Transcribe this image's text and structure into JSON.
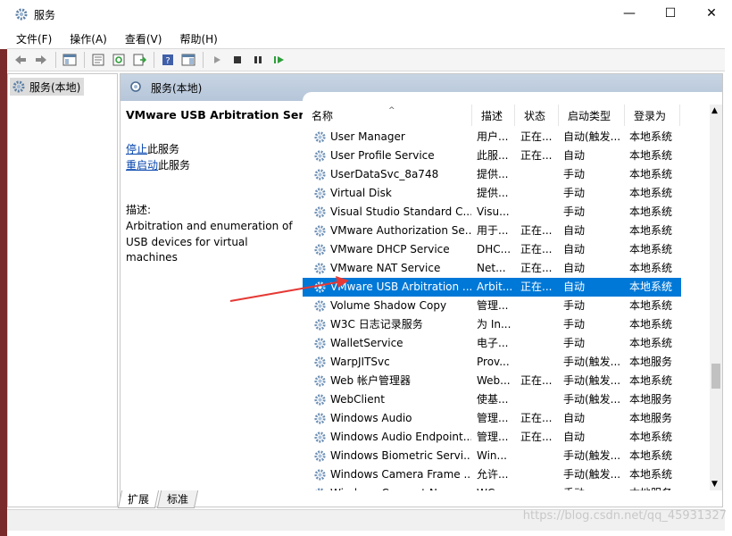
{
  "window": {
    "title": "服务",
    "buttons": [
      "—",
      "☐",
      "✕"
    ]
  },
  "menu": [
    "文件(F)",
    "操作(A)",
    "查看(V)",
    "帮助(H)"
  ],
  "tree": {
    "item": "服务(本地)"
  },
  "panel": {
    "header": "服务(本地)"
  },
  "description_panel": {
    "service_title": "VMware USB Arbitration Service",
    "stop_link": "停止",
    "stop_suffix": "此服务",
    "restart_link": "重启动",
    "restart_suffix": "此服务",
    "desc_label": "描述:",
    "desc_text": "Arbitration and enumeration of USB devices for virtual machines"
  },
  "columns": [
    "名称",
    "描述",
    "状态",
    "启动类型",
    "登录为"
  ],
  "rows": [
    {
      "name": "User Manager",
      "desc": "用户...",
      "status": "正在...",
      "start": "自动(触发...",
      "logon": "本地系统"
    },
    {
      "name": "User Profile Service",
      "desc": "此服...",
      "status": "正在...",
      "start": "自动",
      "logon": "本地系统"
    },
    {
      "name": "UserDataSvc_8a748",
      "desc": "提供...",
      "status": "",
      "start": "手动",
      "logon": "本地系统"
    },
    {
      "name": "Virtual Disk",
      "desc": "提供...",
      "status": "",
      "start": "手动",
      "logon": "本地系统"
    },
    {
      "name": "Visual Studio Standard C...",
      "desc": "Visu...",
      "status": "",
      "start": "手动",
      "logon": "本地系统"
    },
    {
      "name": "VMware Authorization Se...",
      "desc": "用于...",
      "status": "正在...",
      "start": "自动",
      "logon": "本地系统"
    },
    {
      "name": "VMware DHCP Service",
      "desc": "DHC...",
      "status": "正在...",
      "start": "自动",
      "logon": "本地系统"
    },
    {
      "name": "VMware NAT Service",
      "desc": "Net...",
      "status": "正在...",
      "start": "自动",
      "logon": "本地系统"
    },
    {
      "name": "VMware USB Arbitration ...",
      "desc": "Arbit...",
      "status": "正在...",
      "start": "自动",
      "logon": "本地系统",
      "selected": true
    },
    {
      "name": "Volume Shadow Copy",
      "desc": "管理...",
      "status": "",
      "start": "手动",
      "logon": "本地系统"
    },
    {
      "name": "W3C 日志记录服务",
      "desc": "为 In...",
      "status": "",
      "start": "手动",
      "logon": "本地系统"
    },
    {
      "name": "WalletService",
      "desc": "电子...",
      "status": "",
      "start": "手动",
      "logon": "本地系统"
    },
    {
      "name": "WarpJITSvc",
      "desc": "Prov...",
      "status": "",
      "start": "手动(触发...",
      "logon": "本地服务"
    },
    {
      "name": "Web 帐户管理器",
      "desc": "Web...",
      "status": "正在...",
      "start": "手动(触发...",
      "logon": "本地系统"
    },
    {
      "name": "WebClient",
      "desc": "使基...",
      "status": "",
      "start": "手动(触发...",
      "logon": "本地服务"
    },
    {
      "name": "Windows Audio",
      "desc": "管理...",
      "status": "正在...",
      "start": "自动",
      "logon": "本地服务"
    },
    {
      "name": "Windows Audio Endpoint...",
      "desc": "管理...",
      "status": "正在...",
      "start": "自动",
      "logon": "本地系统"
    },
    {
      "name": "Windows Biometric Servi...",
      "desc": "Win...",
      "status": "",
      "start": "手动(触发...",
      "logon": "本地系统"
    },
    {
      "name": "Windows Camera Frame ...",
      "desc": "允许...",
      "status": "",
      "start": "手动(触发...",
      "logon": "本地系统"
    },
    {
      "name": "Windows Connect Now...",
      "desc": "WC...",
      "status": "",
      "start": "手动",
      "logon": "本地服务"
    }
  ],
  "tabs": [
    "扩展",
    "标准"
  ],
  "watermark": "https://blog.csdn.net/qq_45931327",
  "colors": {
    "selection": "#0078d7",
    "arrow": "#e53935",
    "link": "#0645ad"
  }
}
